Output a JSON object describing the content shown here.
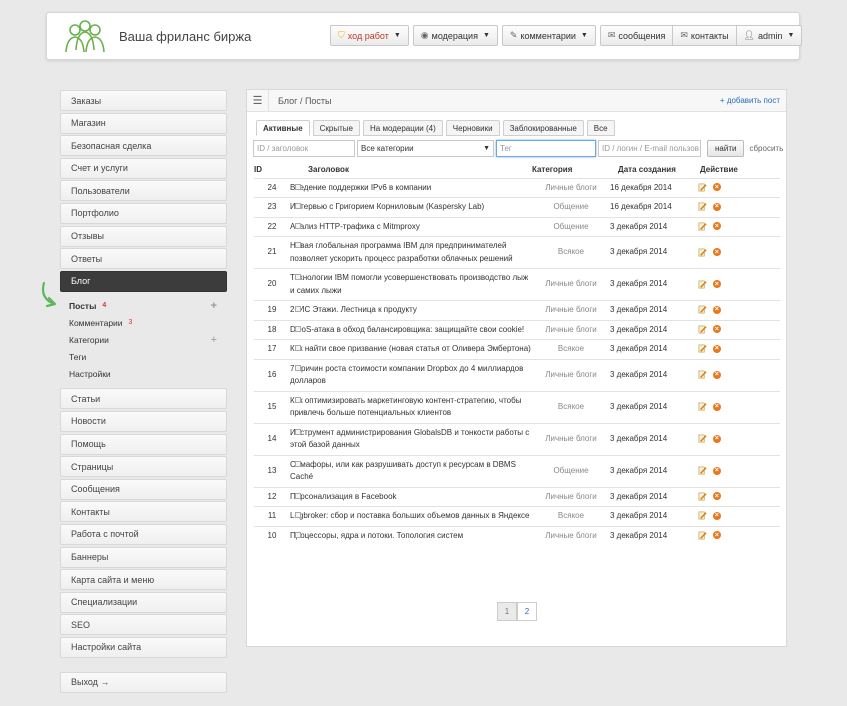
{
  "header": {
    "site_title": "Ваша фриланс биржа",
    "nav": [
      {
        "label": "ход работ",
        "icon": "shield-icon",
        "dropdown": true
      },
      {
        "label": "модерация",
        "icon": "eye-icon",
        "dropdown": true
      },
      {
        "label": "комментарии",
        "icon": "pencil-icon",
        "dropdown": true
      }
    ],
    "nav_group": [
      {
        "label": "сообщения",
        "icon": "envelope-icon"
      },
      {
        "label": "контакты",
        "icon": "envelope-icon"
      },
      {
        "label": "admin",
        "icon": "user-icon",
        "dropdown": true
      }
    ]
  },
  "sidebar": {
    "items_top": [
      "Заказы",
      "Магазин",
      "Безопасная сделка",
      "Счет и услуги",
      "Пользователи",
      "Портфолио",
      "Отзывы",
      "Ответы"
    ],
    "active": "Блог",
    "sub_items": [
      {
        "label": "Посты",
        "count": "4",
        "plus": true,
        "bold": true
      },
      {
        "label": "Комментарии",
        "count": "3",
        "plus": false,
        "bold": false
      },
      {
        "label": "Категории",
        "count": "",
        "plus": true,
        "bold": false
      },
      {
        "label": "Теги",
        "count": "",
        "plus": false,
        "bold": false
      },
      {
        "label": "Настройки",
        "count": "",
        "plus": false,
        "bold": false
      }
    ],
    "items_bottom": [
      "Статьи",
      "Новости",
      "Помощь",
      "Страницы",
      "Сообщения",
      "Контакты",
      "Работа с почтой",
      "Баннеры",
      "Карта сайта и меню",
      "Специализации",
      "SEO",
      "Настройки сайта"
    ],
    "logout": "Выход →"
  },
  "panel": {
    "breadcrumb": "Блог / Посты",
    "add_link": "+ добавить пост",
    "tabs": [
      "Активные",
      "Скрытые",
      "На модерации (4)",
      "Черновики",
      "Заблокированные",
      "Все"
    ],
    "filters": {
      "id_placeholder": "ID / заголовок",
      "category_value": "Все категории",
      "tag_placeholder": "Тег",
      "user_placeholder": "ID / логин / E-mail пользов",
      "find_label": "найти",
      "reset_label": "сбросить"
    },
    "columns": {
      "id": "ID",
      "title": "Заголовок",
      "category": "Категория",
      "date": "Дата создания",
      "action": "Действие"
    },
    "rows": [
      {
        "id": "24",
        "title": "Введение поддержки IPv6 в компании",
        "category": "Личные блоги",
        "date": "16 декабря 2014"
      },
      {
        "id": "23",
        "title": "Интервью с Григорием Корниловым (Kaspersky Lab)",
        "category": "Общение",
        "date": "16 декабря 2014"
      },
      {
        "id": "22",
        "title": "Анализ HTTP-трафика с Mitmproxy",
        "category": "Общение",
        "date": "3 декабря 2014"
      },
      {
        "id": "21",
        "title": "Новая глобальная программа IBM для предпринимателей позволяет ускорить процесс разработки облачных решений",
        "category": "Всякое",
        "date": "3 декабря 2014"
      },
      {
        "id": "20",
        "title": "Технологии IBM помогли усовершенствовать производство лыж и самих лыжи",
        "category": "Личные блоги",
        "date": "3 декабря 2014"
      },
      {
        "id": "19",
        "title": "2ГИС Этажи. Лестница к продукту",
        "category": "Личные блоги",
        "date": "3 декабря 2014"
      },
      {
        "id": "18",
        "title": "DDoS-атака в обход балансировщика: защищайте свои cookie!",
        "category": "Личные блоги",
        "date": "3 декабря 2014"
      },
      {
        "id": "17",
        "title": "Как найти свое призвание (новая статья от Оливера Эмбертона)",
        "category": "Всякое",
        "date": "3 декабря 2014"
      },
      {
        "id": "16",
        "title": "7 причин роста стоимости компании Dropbox до 4 миллиардов долларов",
        "category": "Личные блоги",
        "date": "3 декабря 2014"
      },
      {
        "id": "15",
        "title": "Как оптимизировать маркетинговую контент-стратегию, чтобы привлечь больше потенциальных клиентов",
        "category": "Всякое",
        "date": "3 декабря 2014"
      },
      {
        "id": "14",
        "title": "Инструмент администрирования GlobalsDB и тонкости работы с этой базой данных",
        "category": "Личные блоги",
        "date": "3 декабря 2014"
      },
      {
        "id": "13",
        "title": "Семафоры, или как разрушивать доступ к ресурсам в DBMS Caché",
        "category": "Общение",
        "date": "3 декабря 2014"
      },
      {
        "id": "12",
        "title": "Персонализация в Facebook",
        "category": "Личные блоги",
        "date": "3 декабря 2014"
      },
      {
        "id": "11",
        "title": "Logbroker: сбор и поставка больших объемов данных в Яндексе",
        "category": "Всякое",
        "date": "3 декабря 2014"
      },
      {
        "id": "10",
        "title": "Процессоры, ядра и потоки. Топология систем",
        "category": "Личные блоги",
        "date": "3 декабря 2014"
      }
    ],
    "pagination": [
      "1",
      "2"
    ],
    "current_page": "1"
  }
}
